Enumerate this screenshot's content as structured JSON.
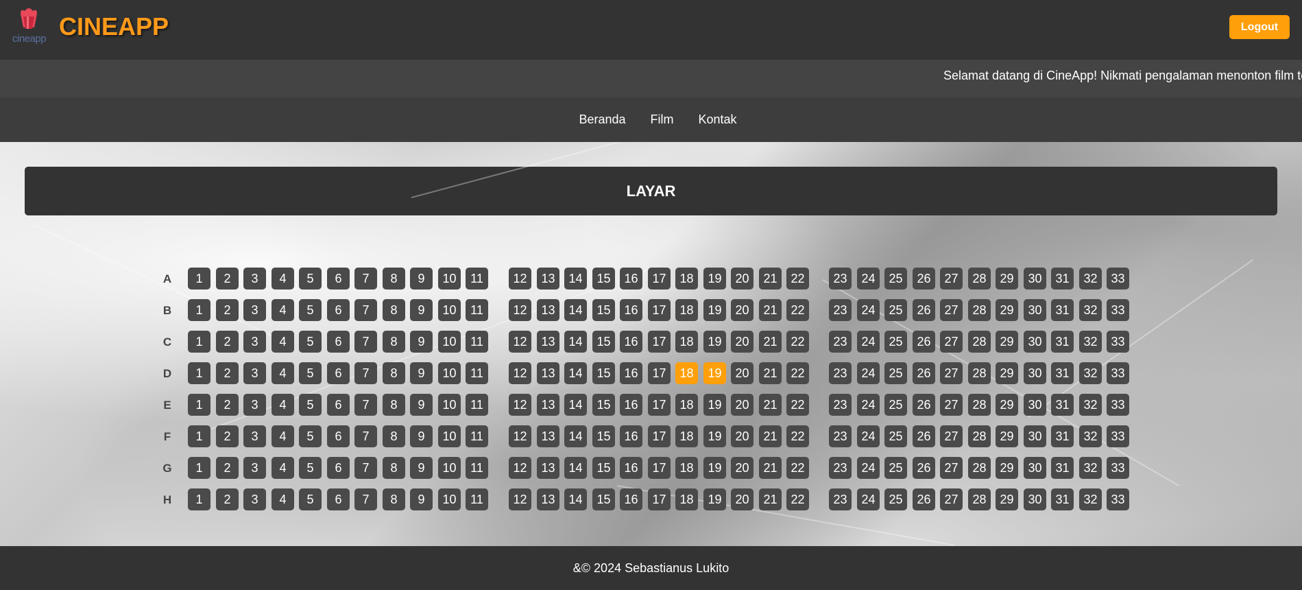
{
  "header": {
    "logo_text": "cineapp",
    "brand": "CINEAPP",
    "logout_label": "Logout"
  },
  "marquee": {
    "text": "Selamat datang di CineApp! Nikmati pengalaman menonton film terbaik bersama kami."
  },
  "nav": {
    "items": [
      "Beranda",
      "Film",
      "Kontak"
    ]
  },
  "screen": {
    "label": "LAYAR"
  },
  "seating": {
    "rows": [
      "A",
      "B",
      "C",
      "D",
      "E",
      "F",
      "G",
      "H"
    ],
    "seat_numbers": [
      1,
      2,
      3,
      4,
      5,
      6,
      7,
      8,
      9,
      10,
      11,
      12,
      13,
      14,
      15,
      16,
      17,
      18,
      19,
      20,
      21,
      22,
      23,
      24,
      25,
      26,
      27,
      28,
      29,
      30,
      31,
      32,
      33
    ],
    "selected": [
      {
        "row": "D",
        "seat": 18
      },
      {
        "row": "D",
        "seat": 19
      }
    ]
  },
  "colors": {
    "accent": "#ff9f0a",
    "seat": "#4a4a4a",
    "bar": "#333333"
  },
  "footer": {
    "text": "&© 2024 Sebastianus Lukito"
  }
}
